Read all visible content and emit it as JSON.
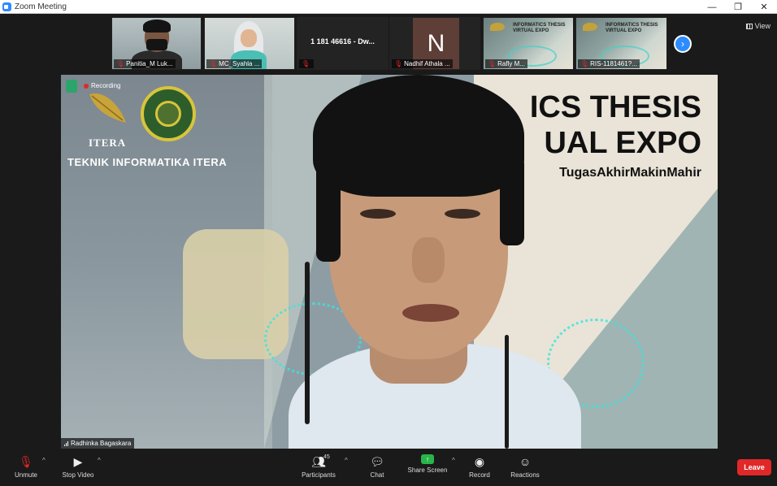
{
  "window": {
    "title": "Zoom Meeting",
    "minimize_glyph": "—",
    "restore_glyph": "❐",
    "close_glyph": "✕"
  },
  "gallery": {
    "view_label": "View",
    "next_icon": "chevron-right-icon",
    "thumbnails": [
      {
        "name": "Panitia_M Luk...",
        "muted": true,
        "kind": "camera"
      },
      {
        "name": "MC_Syahla ...",
        "muted": true,
        "kind": "camera"
      },
      {
        "name": "1 181 46616 - Dw...",
        "muted": true,
        "kind": "name-only"
      },
      {
        "name": "Nadhif Athala ...",
        "muted": true,
        "kind": "avatar",
        "initial": "N",
        "avatar_color": "#5d3f37"
      },
      {
        "name": "Rafly M...",
        "muted": true,
        "kind": "poster"
      },
      {
        "name": "RIS-1181461?...",
        "muted": true,
        "kind": "poster"
      }
    ],
    "poster_thumb_title": "INFORMATICS THESIS VIRTUAL EXPO"
  },
  "main_video": {
    "recording_label": "Recording",
    "itera_text": "ITERA",
    "program_name": "TEKNIK INFORMATIKA ITERA",
    "expo_line1": "ICS THESIS",
    "expo_line2": "UAL EXPO",
    "expo_line3": "TugasAkhirMakinMahir",
    "speaker_name": "Radhinka Bagaskara"
  },
  "toolbar": {
    "unmute_label": "Unmute",
    "stop_video_label": "Stop Video",
    "participants_label": "Participants",
    "participants_count": "45",
    "chat_label": "Chat",
    "share_label": "Share Screen",
    "record_label": "Record",
    "reactions_label": "Reactions",
    "leave_label": "Leave"
  },
  "colors": {
    "accent_blue": "#2d8cff",
    "leave_red": "#e02828",
    "share_green": "#28b44a",
    "background": "#1a1a1a"
  }
}
